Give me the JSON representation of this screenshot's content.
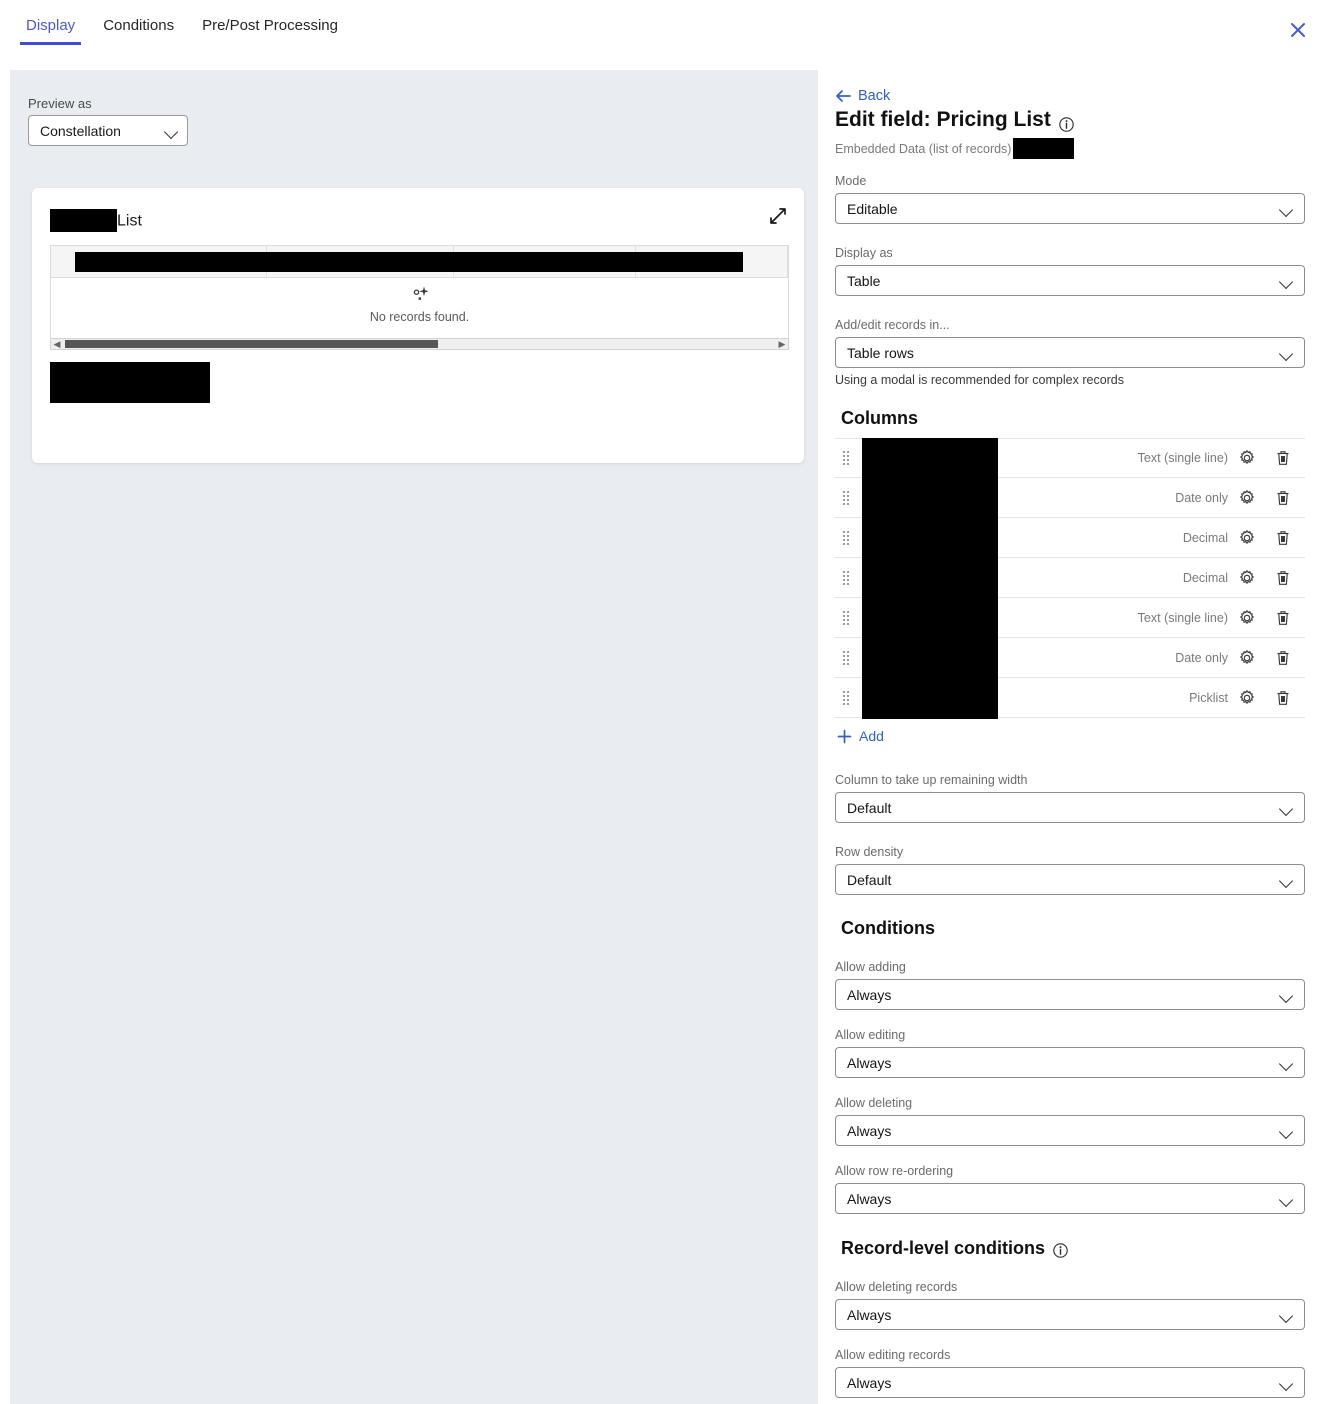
{
  "tabs": [
    {
      "label": "Display",
      "active": true
    },
    {
      "label": "Conditions",
      "active": false
    },
    {
      "label": "Pre/Post Processing",
      "active": false
    }
  ],
  "window": {
    "close_icon": "close-icon",
    "accent_color": "#3c4fd0",
    "link_color": "#2f5fcf"
  },
  "preview": {
    "preview_as_label": "Preview as",
    "preview_as_value": "Constellation",
    "card": {
      "title_suffix": "List",
      "title_redacted": true,
      "expand_icon": "expand-icon",
      "empty_state_icon": "sparkle-icon",
      "empty_text": "No records found.",
      "scrollbar_left_icon": "scroll-left-arrow-icon",
      "scrollbar_right_icon": "scroll-right-arrow-icon"
    }
  },
  "settings": {
    "back_label": "Back",
    "back_icon": "arrow-left-icon",
    "title": "Edit field: Pricing List",
    "title_info_icon": "info-icon",
    "subtitle": "Embedded Data (list of records)",
    "fields": [
      {
        "label": "Mode",
        "value": "Editable",
        "help": ""
      },
      {
        "label": "Display as",
        "value": "Table",
        "help": ""
      },
      {
        "label": "Add/edit records in...",
        "value": "Table rows",
        "help": "Using a modal is recommended for complex records"
      }
    ],
    "columns_heading": "Columns",
    "columns": [
      {
        "type": "Text (single line)"
      },
      {
        "type": "Date only"
      },
      {
        "type": "Decimal"
      },
      {
        "type": "Decimal"
      },
      {
        "type": "Text (single line)"
      },
      {
        "type": "Date only"
      },
      {
        "type": "Picklist"
      }
    ],
    "column_row_icons": {
      "drag": "drag-handle-icon",
      "settings": "gear-icon",
      "delete": "trash-icon"
    },
    "add_label": "Add",
    "add_icon": "plus-icon",
    "width_field": {
      "label": "Column to take up remaining width",
      "value": "Default"
    },
    "density_field": {
      "label": "Row density",
      "value": "Default"
    },
    "conditions_heading": "Conditions",
    "conditions": [
      {
        "label": "Allow adding",
        "value": "Always"
      },
      {
        "label": "Allow editing",
        "value": "Always"
      },
      {
        "label": "Allow deleting",
        "value": "Always"
      },
      {
        "label": "Allow row re-ordering",
        "value": "Always"
      }
    ],
    "record_conditions_heading": "Record-level conditions",
    "record_conditions_info_icon": "info-icon",
    "record_conditions": [
      {
        "label": "Allow deleting records",
        "value": "Always"
      },
      {
        "label": "Allow editing records",
        "value": "Always"
      }
    ]
  }
}
